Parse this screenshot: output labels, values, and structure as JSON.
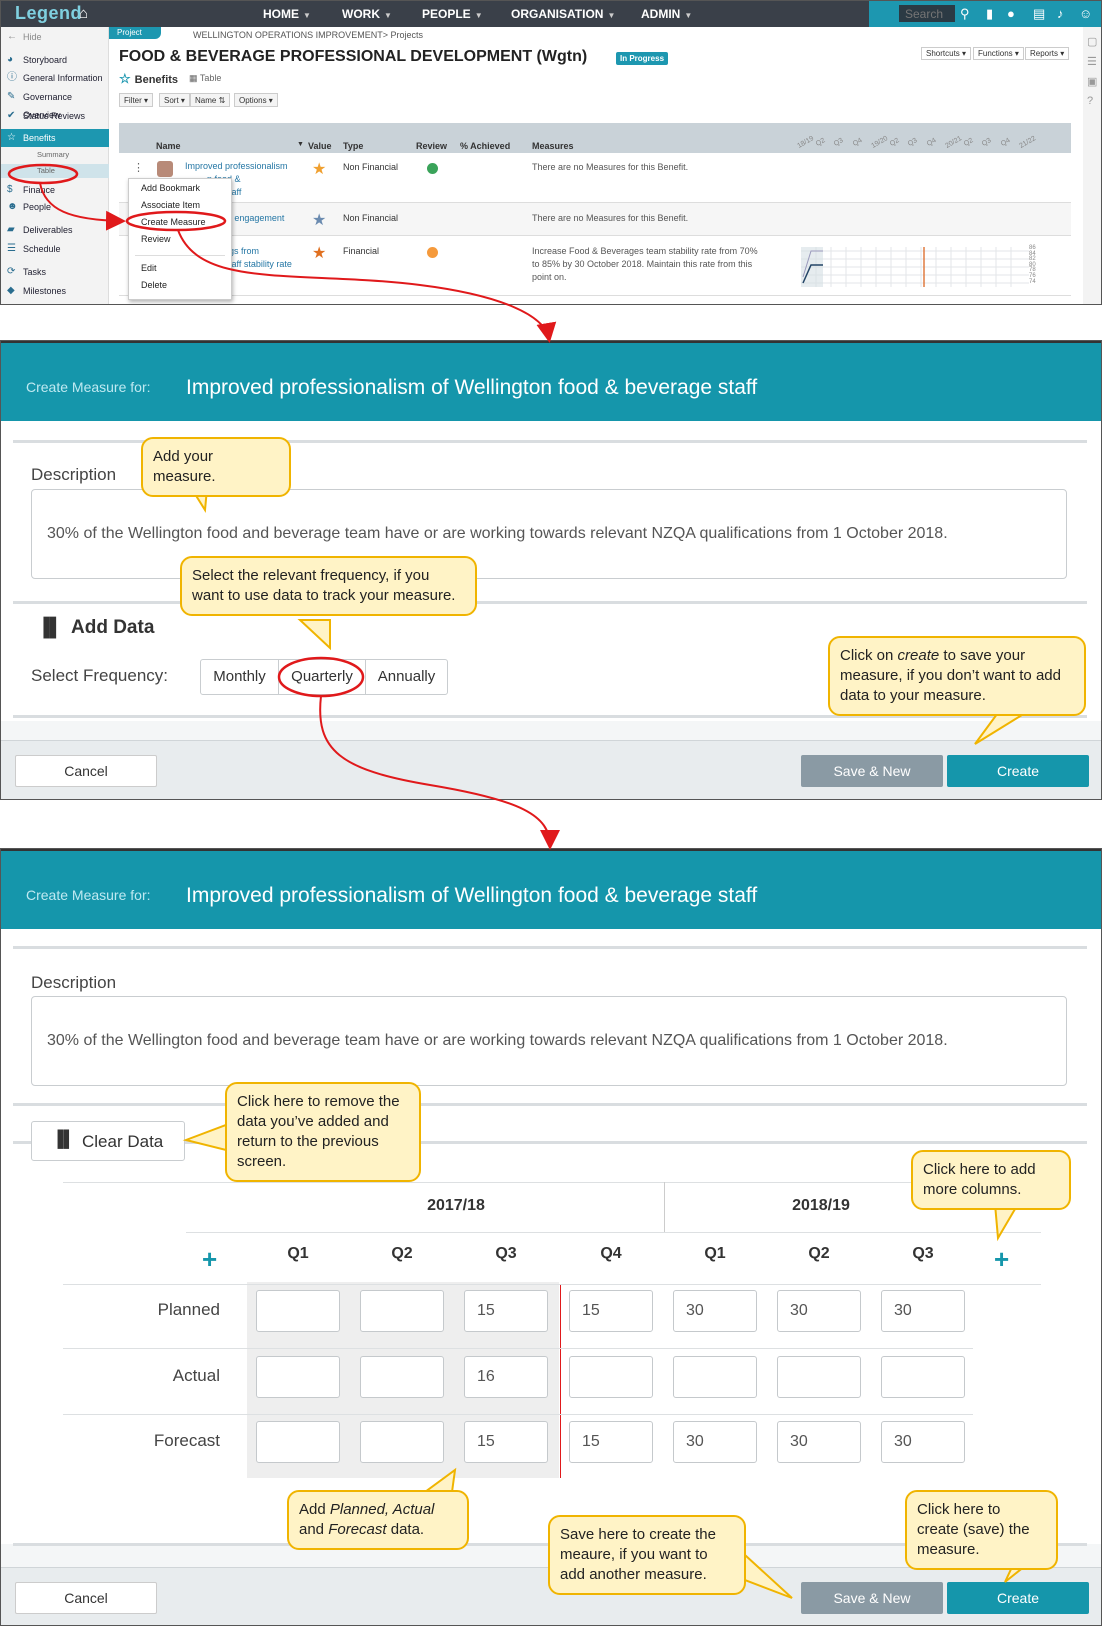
{
  "app": {
    "logo": "Legend",
    "nav": [
      "HOME",
      "WORK",
      "PEOPLE",
      "ORGANISATION",
      "ADMIN"
    ],
    "search_placeholder": "Search"
  },
  "sidebar": {
    "hide": "Hide",
    "items": [
      "Storyboard",
      "General Information",
      "Governance Overview",
      "Status Reviews",
      "Benefits",
      "Finance",
      "People",
      "Deliverables",
      "Schedule",
      "Tasks",
      "Milestones"
    ],
    "sub": [
      "Summary",
      "Table"
    ]
  },
  "project": {
    "tag": "Project",
    "breadcrumb": "WELLINGTON OPERATIONS IMPROVEMENT> Projects",
    "title": "FOOD & BEVERAGE PROFESSIONAL DEVELOPMENT (Wgtn)",
    "status": "In Progress",
    "buttons": [
      "Shortcuts",
      "Functions",
      "Reports"
    ],
    "section": "Benefits",
    "view": "Table",
    "filters": [
      "Filter",
      "Sort",
      "Name",
      "Options"
    ]
  },
  "benefits_table": {
    "headers": [
      "Name",
      "Value",
      "Type",
      "Review",
      "% Achieved",
      "Measures"
    ],
    "quarters": [
      "18/19",
      "Q2",
      "Q3",
      "Q4",
      "19/20",
      "Q2",
      "Q3",
      "Q4",
      "20/21",
      "Q2",
      "Q3",
      "Q4",
      "21/22"
    ],
    "rows": [
      {
        "name_lines": [
          "Improved professionalism",
          "n food &",
          "taff"
        ],
        "type": "Non Financial",
        "review": "#3aa35a",
        "measures": "There are no Measures for this Benefit.",
        "star": "#f0a030"
      },
      {
        "name_lines": [
          "ff engagement"
        ],
        "type": "Non Financial",
        "review": "",
        "measures": "There are no Measures for this Benefit.",
        "star": "#6b8bb0"
      },
      {
        "name_lines": [
          "gs from",
          "taff stability rate"
        ],
        "type": "Financial",
        "review": "#f59a3c",
        "measures_lines": [
          "Increase Food & Beverages team stability rate from 70%",
          "to 85% by 30 October 2018. Maintain this rate from this",
          "point on."
        ],
        "star": "#e07020"
      }
    ],
    "spark_ticks": [
      "86",
      "84",
      "82",
      "80",
      "78",
      "76",
      "74"
    ]
  },
  "context_menu": [
    "Add Bookmark",
    "Associate Item",
    "Create Measure",
    "Review",
    "Edit",
    "Delete"
  ],
  "dialog1": {
    "label": "Create Measure for:",
    "title": "Improved professionalism of Wellington food & beverage staff",
    "description_label": "Description",
    "description": "30% of the Wellington food and beverage team have or are working towards relevant NZQA qualifications from 1 October 2018.",
    "add_data": "Add Data",
    "frequency_label": "Select Frequency:",
    "frequencies": [
      "Monthly",
      "Quarterly",
      "Annually"
    ],
    "cancel": "Cancel",
    "save_new": "Save & New",
    "create": "Create"
  },
  "dialog2": {
    "label": "Create Measure for:",
    "title": "Improved professionalism of Wellington food & beverage staff",
    "description_label": "Description",
    "description": "30% of the Wellington food and beverage team have or are working towards relevant NZQA qualifications from 1 October 2018.",
    "clear_data": "Clear Data",
    "years": [
      "2017/18",
      "2018/19"
    ],
    "quarters": [
      "Q1",
      "Q2",
      "Q3",
      "Q4",
      "Q1",
      "Q2",
      "Q3"
    ],
    "rows": [
      {
        "label": "Planned",
        "values": [
          "",
          "",
          "15",
          "15",
          "30",
          "30",
          "30"
        ]
      },
      {
        "label": "Actual",
        "values": [
          "",
          "",
          "16",
          "",
          "",
          "",
          ""
        ]
      },
      {
        "label": "Forecast",
        "values": [
          "",
          "",
          "15",
          "15",
          "30",
          "30",
          "30"
        ]
      }
    ],
    "cancel": "Cancel",
    "save_new": "Save & New",
    "create": "Create"
  },
  "callouts": {
    "add_measure": "Add your measure.",
    "frequency": "Select the relevant frequency, if you want to use data to track your measure.",
    "create_pre": "Click on ",
    "create_em": "create",
    "create_post": " to save your measure, if you don’t want to add data to your measure.",
    "clear": "Click here to remove the data you’ve added and return to the previous screen.",
    "columns": "Click here to add more columns.",
    "data_pre": "Add ",
    "data_em1": "Planned, Actual",
    "data_mid": " and ",
    "data_em2": "Forecast",
    "data_post": " data.",
    "save_new": "Save here to create the meaure, if you want to add another measure.",
    "create2": "Click here to create (save) the measure."
  },
  "colors": {
    "accent": "#1596ab",
    "annotation": "#e0191b",
    "callout_bg": "#fff3c6",
    "callout_border": "#f0b400"
  }
}
